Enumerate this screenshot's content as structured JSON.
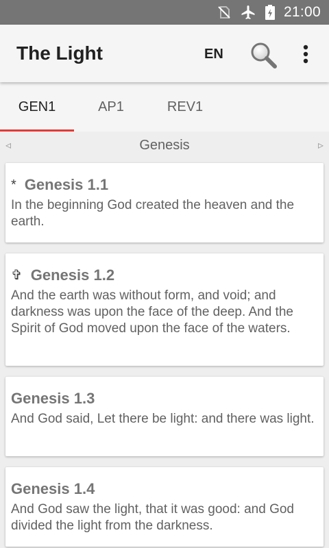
{
  "status_bar": {
    "time": "21:00",
    "icons": [
      "no-sim-icon",
      "airplane-mode-icon",
      "battery-icon"
    ]
  },
  "app_bar": {
    "title": "The Light",
    "language": "EN",
    "actions": [
      "search-icon",
      "overflow-menu-icon"
    ]
  },
  "tabs": [
    {
      "label": "GEN1",
      "active": true
    },
    {
      "label": "AP1",
      "active": false
    },
    {
      "label": "REV1",
      "active": false
    }
  ],
  "chapter_nav": {
    "title": "Genesis",
    "prev_icon": "◃",
    "next_icon": "▹"
  },
  "verses": [
    {
      "marker": "*",
      "ref": "Genesis 1.1",
      "text": "In the beginning God created the heaven and the earth."
    },
    {
      "marker": "✞",
      "ref": "Genesis 1.2",
      "text": "And the earth was without form, and void; and darkness was upon the face of the deep. And the Spirit of God moved upon the face of the waters."
    },
    {
      "marker": "",
      "ref": "Genesis 1.3",
      "text": "And God said, Let there be light: and there was light."
    },
    {
      "marker": "",
      "ref": "Genesis 1.4",
      "text": "And God saw the light, that it was good: and God divided the light from the darkness."
    }
  ],
  "colors": {
    "status_bar": "#757575",
    "app_bar": "#f5f5f5",
    "tab_indicator": "#e53935",
    "background": "#eeeeee"
  }
}
